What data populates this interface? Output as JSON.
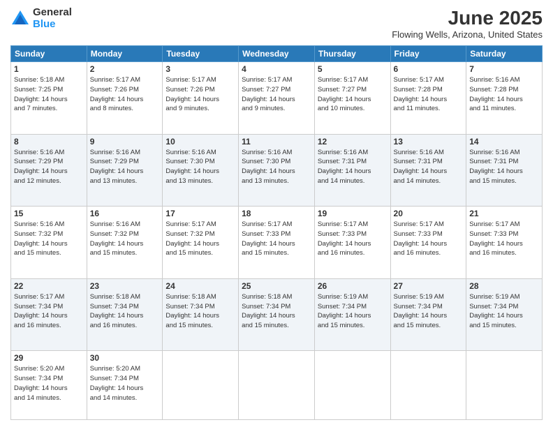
{
  "logo": {
    "general": "General",
    "blue": "Blue"
  },
  "title": "June 2025",
  "location": "Flowing Wells, Arizona, United States",
  "headers": [
    "Sunday",
    "Monday",
    "Tuesday",
    "Wednesday",
    "Thursday",
    "Friday",
    "Saturday"
  ],
  "weeks": [
    [
      {
        "day": "1",
        "info": "Sunrise: 5:18 AM\nSunset: 7:25 PM\nDaylight: 14 hours\nand 7 minutes."
      },
      {
        "day": "2",
        "info": "Sunrise: 5:17 AM\nSunset: 7:26 PM\nDaylight: 14 hours\nand 8 minutes."
      },
      {
        "day": "3",
        "info": "Sunrise: 5:17 AM\nSunset: 7:26 PM\nDaylight: 14 hours\nand 9 minutes."
      },
      {
        "day": "4",
        "info": "Sunrise: 5:17 AM\nSunset: 7:27 PM\nDaylight: 14 hours\nand 9 minutes."
      },
      {
        "day": "5",
        "info": "Sunrise: 5:17 AM\nSunset: 7:27 PM\nDaylight: 14 hours\nand 10 minutes."
      },
      {
        "day": "6",
        "info": "Sunrise: 5:17 AM\nSunset: 7:28 PM\nDaylight: 14 hours\nand 11 minutes."
      },
      {
        "day": "7",
        "info": "Sunrise: 5:16 AM\nSunset: 7:28 PM\nDaylight: 14 hours\nand 11 minutes."
      }
    ],
    [
      {
        "day": "8",
        "info": "Sunrise: 5:16 AM\nSunset: 7:29 PM\nDaylight: 14 hours\nand 12 minutes."
      },
      {
        "day": "9",
        "info": "Sunrise: 5:16 AM\nSunset: 7:29 PM\nDaylight: 14 hours\nand 13 minutes."
      },
      {
        "day": "10",
        "info": "Sunrise: 5:16 AM\nSunset: 7:30 PM\nDaylight: 14 hours\nand 13 minutes."
      },
      {
        "day": "11",
        "info": "Sunrise: 5:16 AM\nSunset: 7:30 PM\nDaylight: 14 hours\nand 13 minutes."
      },
      {
        "day": "12",
        "info": "Sunrise: 5:16 AM\nSunset: 7:31 PM\nDaylight: 14 hours\nand 14 minutes."
      },
      {
        "day": "13",
        "info": "Sunrise: 5:16 AM\nSunset: 7:31 PM\nDaylight: 14 hours\nand 14 minutes."
      },
      {
        "day": "14",
        "info": "Sunrise: 5:16 AM\nSunset: 7:31 PM\nDaylight: 14 hours\nand 15 minutes."
      }
    ],
    [
      {
        "day": "15",
        "info": "Sunrise: 5:16 AM\nSunset: 7:32 PM\nDaylight: 14 hours\nand 15 minutes."
      },
      {
        "day": "16",
        "info": "Sunrise: 5:16 AM\nSunset: 7:32 PM\nDaylight: 14 hours\nand 15 minutes."
      },
      {
        "day": "17",
        "info": "Sunrise: 5:17 AM\nSunset: 7:32 PM\nDaylight: 14 hours\nand 15 minutes."
      },
      {
        "day": "18",
        "info": "Sunrise: 5:17 AM\nSunset: 7:33 PM\nDaylight: 14 hours\nand 15 minutes."
      },
      {
        "day": "19",
        "info": "Sunrise: 5:17 AM\nSunset: 7:33 PM\nDaylight: 14 hours\nand 16 minutes."
      },
      {
        "day": "20",
        "info": "Sunrise: 5:17 AM\nSunset: 7:33 PM\nDaylight: 14 hours\nand 16 minutes."
      },
      {
        "day": "21",
        "info": "Sunrise: 5:17 AM\nSunset: 7:33 PM\nDaylight: 14 hours\nand 16 minutes."
      }
    ],
    [
      {
        "day": "22",
        "info": "Sunrise: 5:17 AM\nSunset: 7:34 PM\nDaylight: 14 hours\nand 16 minutes."
      },
      {
        "day": "23",
        "info": "Sunrise: 5:18 AM\nSunset: 7:34 PM\nDaylight: 14 hours\nand 16 minutes."
      },
      {
        "day": "24",
        "info": "Sunrise: 5:18 AM\nSunset: 7:34 PM\nDaylight: 14 hours\nand 15 minutes."
      },
      {
        "day": "25",
        "info": "Sunrise: 5:18 AM\nSunset: 7:34 PM\nDaylight: 14 hours\nand 15 minutes."
      },
      {
        "day": "26",
        "info": "Sunrise: 5:19 AM\nSunset: 7:34 PM\nDaylight: 14 hours\nand 15 minutes."
      },
      {
        "day": "27",
        "info": "Sunrise: 5:19 AM\nSunset: 7:34 PM\nDaylight: 14 hours\nand 15 minutes."
      },
      {
        "day": "28",
        "info": "Sunrise: 5:19 AM\nSunset: 7:34 PM\nDaylight: 14 hours\nand 15 minutes."
      }
    ],
    [
      {
        "day": "29",
        "info": "Sunrise: 5:20 AM\nSunset: 7:34 PM\nDaylight: 14 hours\nand 14 minutes."
      },
      {
        "day": "30",
        "info": "Sunrise: 5:20 AM\nSunset: 7:34 PM\nDaylight: 14 hours\nand 14 minutes."
      },
      {
        "day": "",
        "info": ""
      },
      {
        "day": "",
        "info": ""
      },
      {
        "day": "",
        "info": ""
      },
      {
        "day": "",
        "info": ""
      },
      {
        "day": "",
        "info": ""
      }
    ]
  ]
}
